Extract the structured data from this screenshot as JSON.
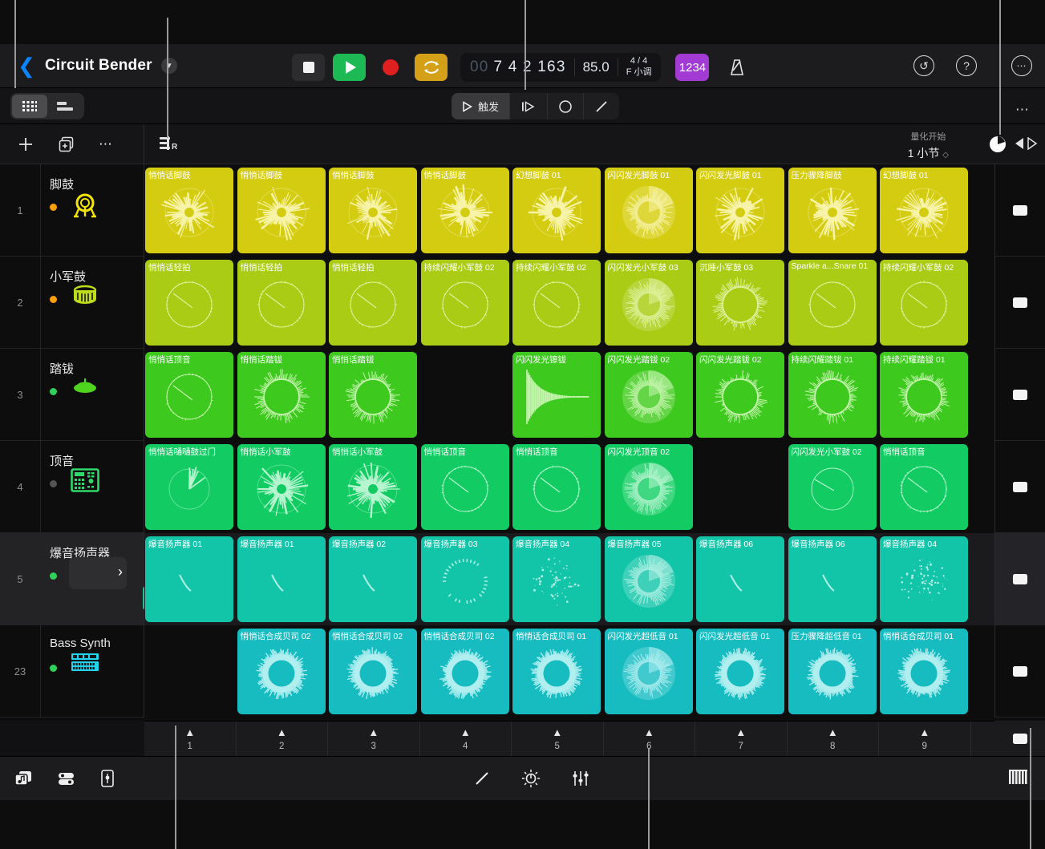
{
  "header": {
    "back_icon": "chevron-left-icon",
    "project_title": "Circuit Bender",
    "disclosure_icon": "chevron-down-icon",
    "undo_icon": "undo-icon",
    "help_icon": "help-icon",
    "more_icon": "more-circle-icon"
  },
  "transport": {
    "stop_icon": "stop-icon",
    "play_icon": "play-icon",
    "record_icon": "record-icon",
    "cycle_icon": "cycle-icon",
    "position_dim": "00",
    "position": "7 4 2 163",
    "tempo": "85.0",
    "time_signature": "4 / 4",
    "key_signature": "F 小调",
    "count_in_label": "1234",
    "metronome_icon": "metronome-icon"
  },
  "view_switch": {
    "grid_icon": "grid-view-icon",
    "list_icon": "tracks-view-icon"
  },
  "mode_toolbar": {
    "items": [
      {
        "label": "触发",
        "icon": "play-outline-icon",
        "selected": true
      },
      {
        "label": "",
        "icon": "step-play-icon",
        "selected": false
      },
      {
        "label": "",
        "icon": "circle-icon",
        "selected": false
      },
      {
        "label": "",
        "icon": "pencil-icon",
        "selected": false
      }
    ],
    "overflow_icon": "ellipsis-icon"
  },
  "track_tools": {
    "add_icon": "plus-icon",
    "duplicate_icon": "duplicate-icon",
    "more_icon": "ellipsis-icon",
    "record_enable_icon": "record-list-icon",
    "quantize_label": "量化开始",
    "quantize_value": "1 小节",
    "quantize_chevron": "chevron-updown-icon",
    "pie_icon": "quantize-pie-icon",
    "play_stop_icon": "play-stop-icon"
  },
  "tracks": [
    {
      "number": "1",
      "name": "脚鼓",
      "dot": "#ff9f0a",
      "icon": "kick-drum-icon",
      "icon_color": "#f3e600",
      "selected": false,
      "has_box": false
    },
    {
      "number": "2",
      "name": "小军鼓",
      "dot": "#ff9f0a",
      "icon": "snare-drum-icon",
      "icon_color": "#bedb17",
      "selected": false,
      "has_box": false
    },
    {
      "number": "3",
      "name": "踏钹",
      "dot": "#30d158",
      "icon": "hihat-icon",
      "icon_color": "#4fd31e",
      "selected": false,
      "has_box": false
    },
    {
      "number": "4",
      "name": "顶音",
      "dot": "#555555",
      "icon": "drum-machine-icon",
      "icon_color": "#2fd96a",
      "selected": false,
      "has_box": false
    },
    {
      "number": "5",
      "name": "爆音扬声器",
      "dot": "#30d158",
      "icon": "drum-machine-icon",
      "icon_color": "#1dd6a8",
      "selected": true,
      "has_box": true,
      "arrow": "chevron-right-icon"
    },
    {
      "number": "23",
      "name": "Bass Synth",
      "dot": "#30d158",
      "icon": "synth-keys-icon",
      "icon_color": "#22d3ee",
      "selected": false,
      "has_box": false
    }
  ],
  "cell_colors": [
    {
      "bg": "#d4cc10",
      "wave": "#f7f3a8"
    },
    {
      "bg": "#aacc15",
      "wave": "#e0f2a0"
    },
    {
      "bg": "#3dc91e",
      "wave": "#c7f5b0"
    },
    {
      "bg": "#12cc63",
      "wave": "#b6f5d0"
    },
    {
      "bg": "#12c4a8",
      "wave": "#b0f0e4"
    },
    {
      "bg": "#17bcc0",
      "wave": "#b0eef0"
    }
  ],
  "rows": [
    {
      "track": "脚鼓",
      "cells": [
        {
          "label": "悄悄话脚鼓",
          "art": "burst"
        },
        {
          "label": "悄悄话脚鼓",
          "art": "burst"
        },
        {
          "label": "悄悄话脚鼓",
          "art": "burst"
        },
        {
          "label": "悄悄话脚鼓",
          "art": "burst"
        },
        {
          "label": "幻想脚鼓 01",
          "art": "burst"
        },
        {
          "label": "闪闪发光脚鼓 01",
          "art": "playing"
        },
        {
          "label": "闪闪发光脚鼓 01",
          "art": "burst"
        },
        {
          "label": "压力骤降脚鼓",
          "art": "burst"
        },
        {
          "label": "幻想脚鼓 01",
          "art": "burst"
        }
      ]
    },
    {
      "track": "小军鼓",
      "cells": [
        {
          "label": "悄悄话轻拍",
          "art": "ring"
        },
        {
          "label": "悄悄话轻拍",
          "art": "ring"
        },
        {
          "label": "悄悄话轻拍",
          "art": "ring"
        },
        {
          "label": "持续闪耀小军鼓 02",
          "art": "ring"
        },
        {
          "label": "持续闪耀小军鼓 02",
          "art": "ring"
        },
        {
          "label": "闪闪发光小军鼓 03",
          "art": "playing"
        },
        {
          "label": "沉睡小军鼓 03",
          "art": "spiky"
        },
        {
          "label": "Sparkle a...Snare 01",
          "art": "ring"
        },
        {
          "label": "持续闪耀小军鼓 02",
          "art": "ring"
        }
      ]
    },
    {
      "track": "踏钹",
      "cells": [
        {
          "label": "悄悄话顶音",
          "art": "ring"
        },
        {
          "label": "悄悄话踏钹",
          "art": "spiky"
        },
        {
          "label": "悄悄话踏钹",
          "art": "spiky"
        },
        {
          "label": "",
          "art": "empty"
        },
        {
          "label": "闪闪发光镲钹",
          "art": "decay"
        },
        {
          "label": "闪闪发光踏钹 02",
          "art": "playing"
        },
        {
          "label": "闪闪发光踏钹 02",
          "art": "spiky"
        },
        {
          "label": "持续闪耀踏钹 01",
          "art": "spiky"
        },
        {
          "label": "持续闪耀踏钹 01",
          "art": "spiky"
        }
      ]
    },
    {
      "track": "顶音",
      "cells": [
        {
          "label": "悄悄话嗵嗵鼓过门",
          "art": "sparse"
        },
        {
          "label": "悄悄话小军鼓",
          "art": "burst"
        },
        {
          "label": "悄悄话小军鼓",
          "art": "burst"
        },
        {
          "label": "悄悄话顶音",
          "art": "ring"
        },
        {
          "label": "悄悄话顶音",
          "art": "ring"
        },
        {
          "label": "闪闪发光顶音 02",
          "art": "playing"
        },
        {
          "label": "",
          "art": "empty"
        },
        {
          "label": "闪闪发光小军鼓 02",
          "art": "thin"
        },
        {
          "label": "悄悄话顶音",
          "art": "ring"
        }
      ]
    },
    {
      "track": "爆音扬声器",
      "cells": [
        {
          "label": "爆音扬声器 01",
          "art": "arc"
        },
        {
          "label": "爆音扬声器 01",
          "art": "arc"
        },
        {
          "label": "爆音扬声器 02",
          "art": "arc"
        },
        {
          "label": "爆音扬声器 03",
          "art": "dashring"
        },
        {
          "label": "爆音扬声器 04",
          "art": "dots"
        },
        {
          "label": "爆音扬声器 05",
          "art": "playing"
        },
        {
          "label": "爆音扬声器 06",
          "art": "arc"
        },
        {
          "label": "爆音扬声器 06",
          "art": "arc"
        },
        {
          "label": "爆音扬声器 04",
          "art": "dots"
        }
      ]
    },
    {
      "track": "Bass Synth",
      "cells": [
        {
          "label": "",
          "art": "empty"
        },
        {
          "label": "悄悄话合成贝司 02",
          "art": "thickring"
        },
        {
          "label": "悄悄话合成贝司 02",
          "art": "thickring"
        },
        {
          "label": "悄悄话合成贝司 02",
          "art": "thickring"
        },
        {
          "label": "悄悄话合成贝司 01",
          "art": "thickring"
        },
        {
          "label": "闪闪发光超低音 01",
          "art": "playing"
        },
        {
          "label": "闪闪发光超低音 01",
          "art": "thickring"
        },
        {
          "label": "压力骤降超低音 01",
          "art": "thickring"
        },
        {
          "label": "悄悄话合成贝司 01",
          "art": "thickring"
        }
      ]
    }
  ],
  "scenes": [
    {
      "number": "1",
      "icon": "chevron-up-icon"
    },
    {
      "number": "2",
      "icon": "chevron-up-icon"
    },
    {
      "number": "3",
      "icon": "chevron-up-icon"
    },
    {
      "number": "4",
      "icon": "chevron-up-icon"
    },
    {
      "number": "5",
      "icon": "chevron-up-icon"
    },
    {
      "number": "6",
      "icon": "chevron-up-icon"
    },
    {
      "number": "7",
      "icon": "chevron-up-icon"
    },
    {
      "number": "8",
      "icon": "chevron-up-icon"
    },
    {
      "number": "9",
      "icon": "chevron-up-icon"
    }
  ],
  "bottom_bar": {
    "left_icons": [
      "loops-browser-icon",
      "mixer-icon",
      "plugin-icon"
    ],
    "center_icons": [
      "pencil-icon",
      "automation-icon",
      "faders-icon"
    ],
    "right_icon": "piano-keyboard-icon"
  }
}
